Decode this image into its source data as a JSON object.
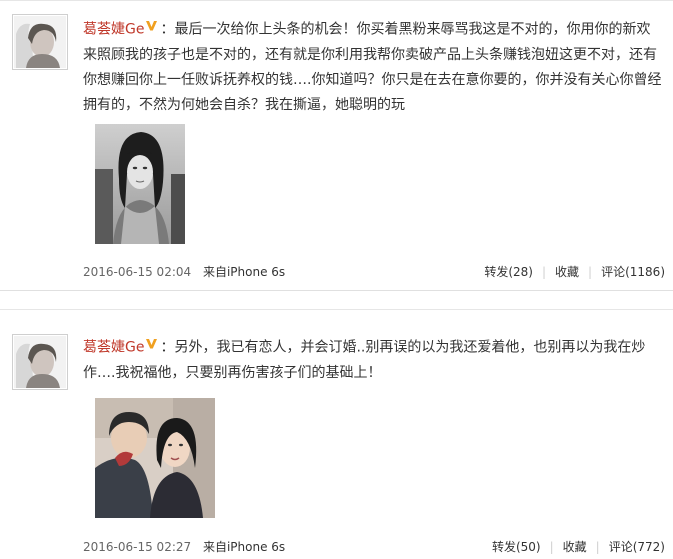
{
  "posts": [
    {
      "author": "葛荟婕Ge",
      "colon": "：",
      "text": "最后一次给你上头条的机会！你买着黑粉来辱骂我这是不对的，你用你的新欢来照顾我的孩子也是不对的，还有就是你利用我帮你卖破产品上头条赚钱泡妞这更不对，还有你想赚回你上一任败诉抚养权的钱….你知道吗？你只是在去在意你要的，你并没有关心你曾经拥有的，不然为何她会自杀？我在撕逼，她聪明的玩",
      "time": "2016-06-15 02:04",
      "source": "来自iPhone 6s",
      "repost_label": "转发(28)",
      "favorite_label": "收藏",
      "comment_label": "评论(1186)"
    },
    {
      "author": "葛荟婕Ge",
      "colon": "：",
      "text": "另外，我已有恋人，并会订婚..别再误的以为我还爱着他，也别再以为我在炒作….我祝福他，只要别再伤害孩子们的基础上！",
      "time": "2016-06-15 02:27",
      "source": "来自iPhone 6s",
      "repost_label": "转发(50)",
      "favorite_label": "收藏",
      "comment_label": "评论(772)"
    }
  ],
  "icons": {
    "verified_badge": "v-badge-icon"
  },
  "colors": {
    "author": "#c0392b",
    "badge": "#f0a020",
    "meta_text": "#666666"
  }
}
